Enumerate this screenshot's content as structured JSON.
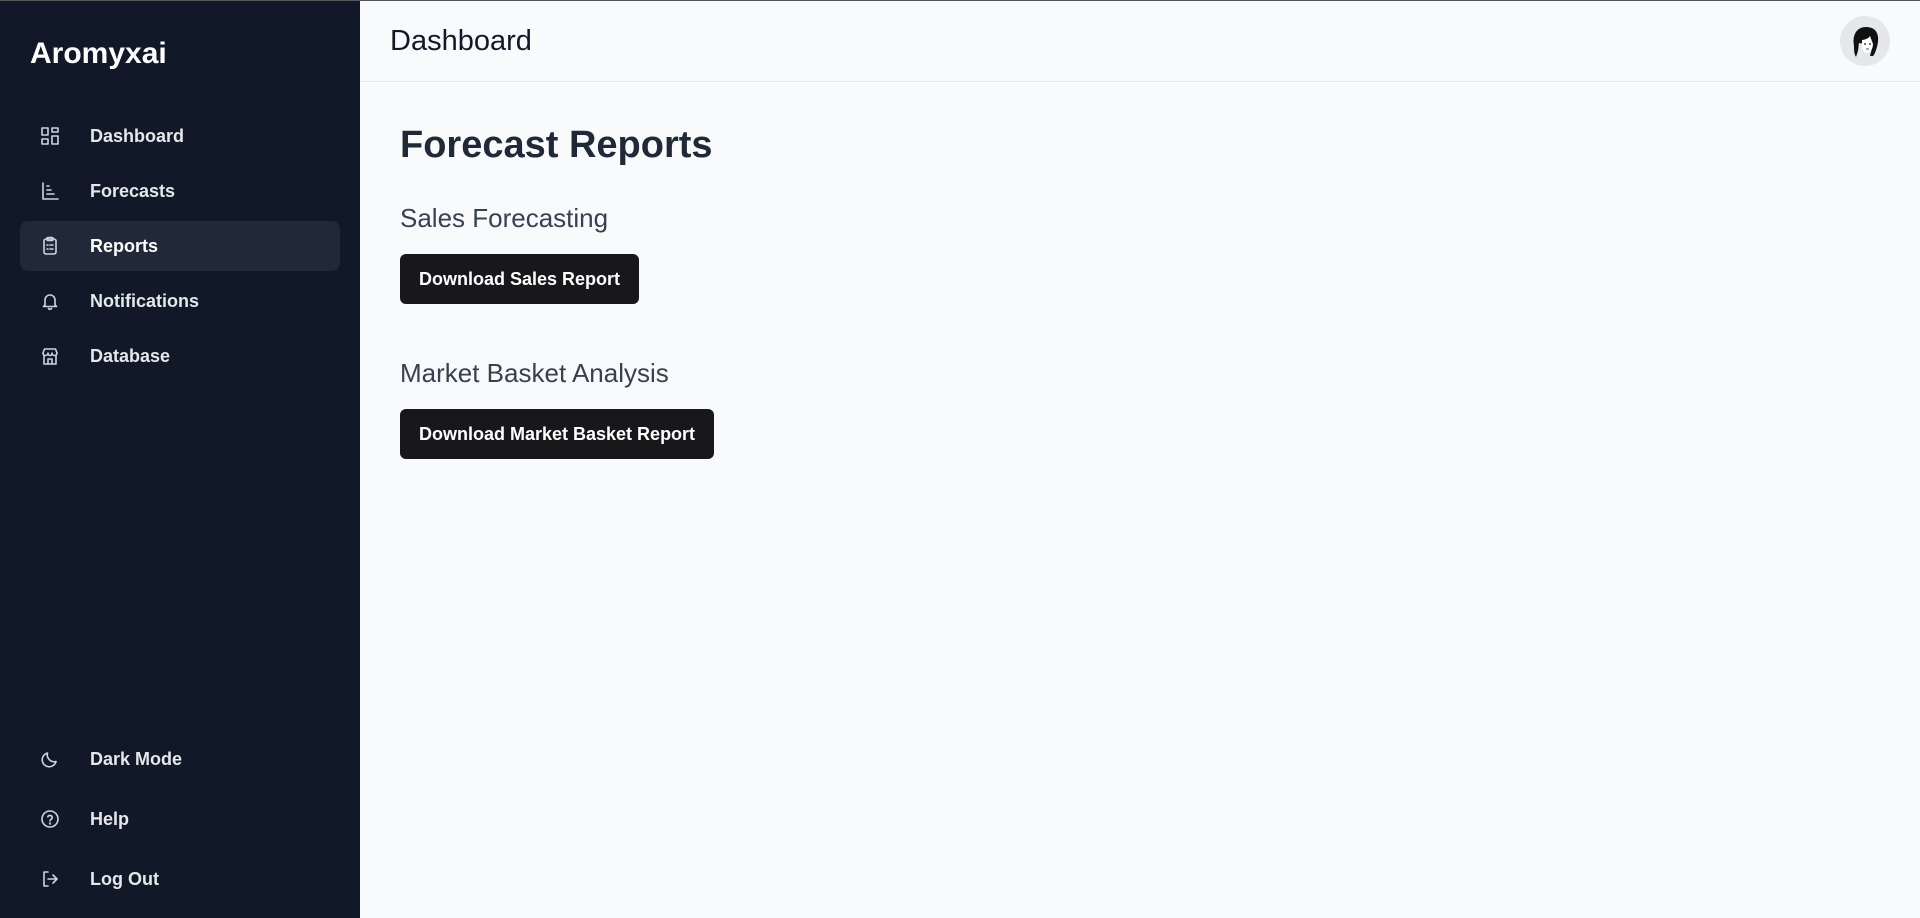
{
  "brand": "Aromyxai",
  "sidebar": {
    "items": [
      {
        "label": "Dashboard",
        "icon": "dashboard-grid-icon"
      },
      {
        "label": "Forecasts",
        "icon": "chart-icon"
      },
      {
        "label": "Reports",
        "icon": "clipboard-icon",
        "active": true
      },
      {
        "label": "Notifications",
        "icon": "bell-icon"
      },
      {
        "label": "Database",
        "icon": "store-icon"
      }
    ],
    "bottom": [
      {
        "label": "Dark Mode",
        "icon": "moon-icon"
      },
      {
        "label": "Help",
        "icon": "help-circle-icon"
      },
      {
        "label": "Log Out",
        "icon": "logout-icon"
      }
    ]
  },
  "header": {
    "title": "Dashboard"
  },
  "main": {
    "page_title": "Forecast Reports",
    "sections": [
      {
        "title": "Sales Forecasting",
        "button": "Download Sales Report"
      },
      {
        "title": "Market Basket Analysis",
        "button": "Download Market Basket Report"
      }
    ]
  },
  "colors": {
    "sidebar_bg": "#111827",
    "active_item_bg": "#1f2937",
    "button_bg": "#18181b",
    "content_bg": "#f9fafb"
  }
}
